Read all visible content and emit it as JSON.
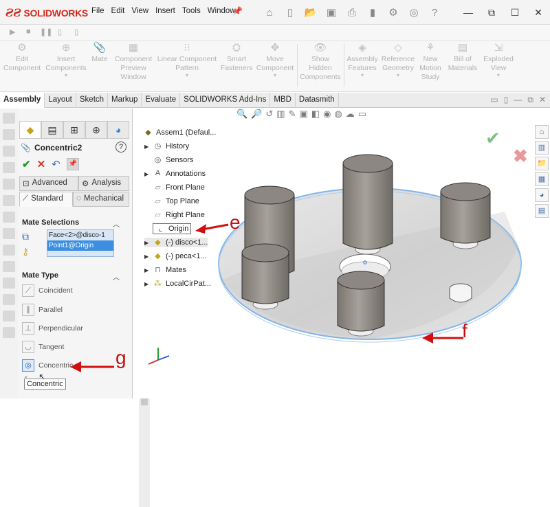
{
  "app": {
    "logo": "SOLIDWORKS"
  },
  "menu": [
    "File",
    "Edit",
    "View",
    "Insert",
    "Tools",
    "Window"
  ],
  "command_manager": [
    {
      "label": "Edit\nComponent",
      "icon": "edit-component-icon"
    },
    {
      "label": "Insert\nComponents",
      "icon": "insert-components-icon"
    },
    {
      "label": "Mate",
      "icon": "mate-icon"
    },
    {
      "label": "Component\nPreview\nWindow",
      "icon": "preview-window-icon"
    },
    {
      "label": "Linear Component\nPattern",
      "icon": "linear-pattern-icon"
    },
    {
      "label": "Smart\nFasteners",
      "icon": "smart-fasteners-icon"
    },
    {
      "label": "Move\nComponent",
      "icon": "move-component-icon"
    },
    {
      "label": "Show\nHidden\nComponents",
      "icon": "show-hidden-icon"
    },
    {
      "label": "Assembly\nFeatures",
      "icon": "assembly-features-icon"
    },
    {
      "label": "Reference\nGeometry",
      "icon": "reference-geometry-icon"
    },
    {
      "label": "New\nMotion\nStudy",
      "icon": "motion-study-icon"
    },
    {
      "label": "Bill of\nMaterials",
      "icon": "bom-icon"
    },
    {
      "label": "Exploded\nView",
      "icon": "exploded-view-icon"
    }
  ],
  "tabs": [
    "Assembly",
    "Layout",
    "Sketch",
    "Markup",
    "Evaluate",
    "SOLIDWORKS Add-Ins",
    "MBD",
    "Datasmith"
  ],
  "active_tab": "Assembly",
  "property_manager": {
    "title": "Concentric2",
    "help": "?",
    "subtabs_row1": [
      "Advanced",
      "Analysis"
    ],
    "subtabs_row2": [
      "Standard",
      "Mechanical"
    ],
    "mate_selections_header": "Mate Selections",
    "selections": [
      "Face<2>@disco-1",
      "Point1@Origin"
    ],
    "mate_type_header": "Mate Type",
    "mate_types": [
      "Coincident",
      "Parallel",
      "Perpendicular",
      "Tangent",
      "Concentric"
    ],
    "tooltip": "Concentric"
  },
  "tree": {
    "root": "Assem1 (Defaul...",
    "items": [
      "History",
      "Sensors",
      "Annotations",
      "Front Plane",
      "Top Plane",
      "Right Plane",
      "Origin",
      "(-) disco<1...",
      "(-) peca<1...",
      "Mates",
      "LocalCirPat..."
    ]
  },
  "callouts": {
    "e": "e",
    "f": "f",
    "g": "g"
  },
  "colors": {
    "brand": "#d52b1e",
    "callout": "#c01010",
    "selection": "#3c8ee0"
  }
}
